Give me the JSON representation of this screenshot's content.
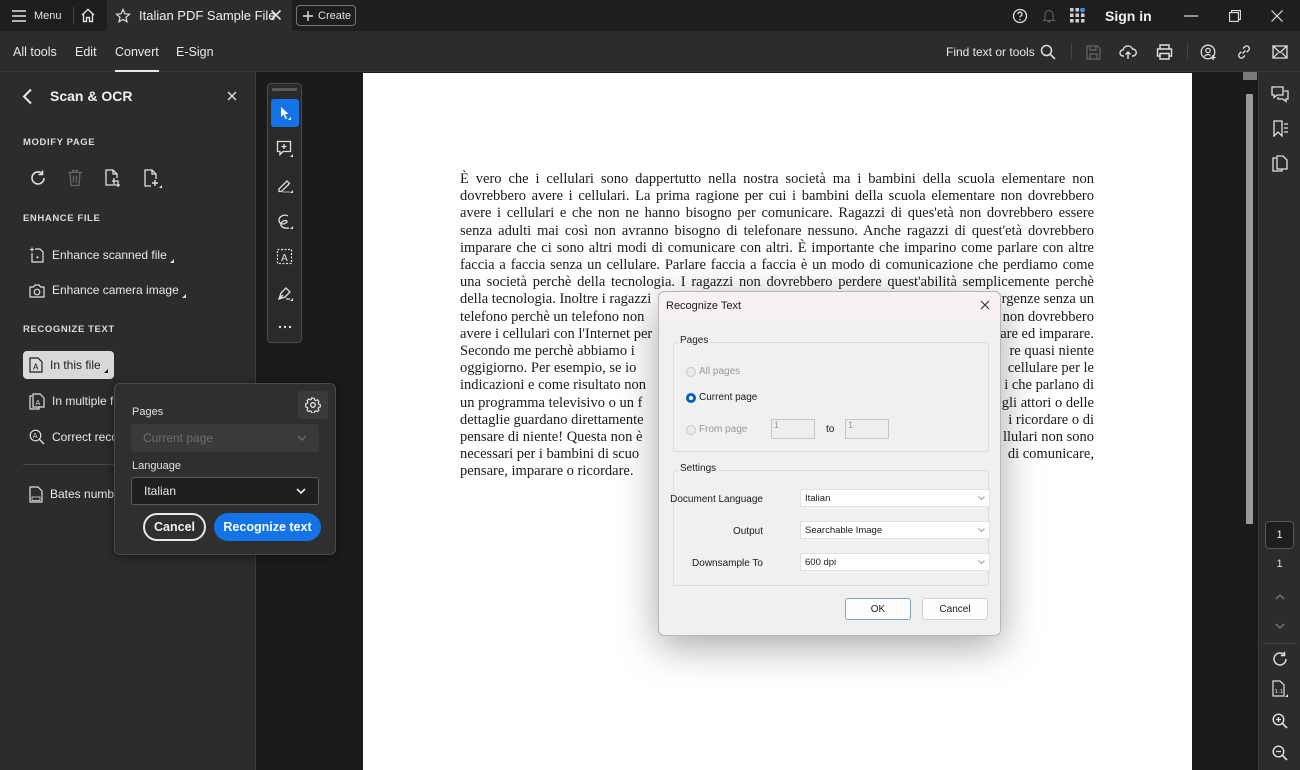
{
  "titlebar": {
    "menu_label": "Menu",
    "tab_title": "Italian PDF Sample File",
    "create_label": "Create",
    "sign_in_label": "Sign in"
  },
  "toolbar": {
    "tabs": [
      {
        "label": "All tools",
        "active": false
      },
      {
        "label": "Edit",
        "active": false
      },
      {
        "label": "Convert",
        "active": true
      },
      {
        "label": "E-Sign",
        "active": false
      }
    ],
    "find_label": "Find text or tools"
  },
  "left_panel": {
    "title": "Scan & OCR",
    "sections": {
      "modify_page": "MODIFY PAGE",
      "enhance_file": "ENHANCE FILE",
      "recognize_text": "RECOGNIZE TEXT"
    },
    "enhance_items": [
      "Enhance scanned file",
      "Enhance camera image"
    ],
    "recognize_items": [
      "In this file",
      "In multiple files",
      "Correct recognized text"
    ],
    "bates_label": "Bates numbering"
  },
  "ocr_popover": {
    "pages_label": "Pages",
    "pages_value": "Current page",
    "language_label": "Language",
    "language_value": "Italian",
    "cancel_label": "Cancel",
    "recognize_label": "Recognize text",
    "accent_color": "#1473e6"
  },
  "document": {
    "lines": [
      "È vero che i cellulari sono dappertutto nella nostra società ma i bambini della scuola elementare non",
      "dovrebbero avere i cellulari. La prima ragione per cui i bambini della scuola elementare non dovrebbero",
      "avere i cellulari e che non ne hanno bisogno per comunicare. Ragazzi di ques'età non dovrebbero essere",
      "senza adulti mai così non avranno bisogno di telefonare nessuno. Anche ragazzi di quest'età dovrebbero",
      "imparare che ci sono altri modi di comunicare con altri. È importante che imparino come parlare con altre",
      "faccia a faccia senza un cellulare. Parlare faccia a faccia è un modo di comunicazione che perdiamo come",
      "una società perchè della tecnologia. I ragazzi non dovrebbero perdere quest'abilità semplicemente perchè",
      "della tecnologia. Inoltre i ragazzi ... rgenze senza un",
      "telefono perchè un telefono non ... non dovrebbero",
      "avere i cellulari con l'Internet per ... are ed imparare.",
      "Secondo me perchè abbiamo i ... re quasi niente",
      "oggigiorno. Per esempio, se io ... cellulare per le",
      "indicazioni e come risultato non ... i che parlano di",
      "un programma televisivo o un f ... gli attori o delle",
      "dettaglie guardano direttamente ... i ricordare o di",
      "pensare di niente! Questa non è ... llulari non sono",
      "necessari per i bambini di scuo ... di comunicare,",
      "pensare, imparare o ricordare."
    ]
  },
  "dialog": {
    "title": "Recognize Text",
    "pages_group": "Pages",
    "radio_all": "All pages",
    "radio_current": "Current page",
    "radio_from": "From page",
    "from_value": "1",
    "to_label": "to",
    "to_value": "1",
    "settings_group": "Settings",
    "doc_language_label": "Document Language",
    "doc_language_value": "Italian",
    "output_label": "Output",
    "output_value": "Searchable Image",
    "downsample_label": "Downsample To",
    "downsample_value": "600 dpi",
    "ok_label": "OK",
    "cancel_label": "Cancel"
  },
  "right_rail": {
    "current_page": "1",
    "total_pages": "1"
  }
}
